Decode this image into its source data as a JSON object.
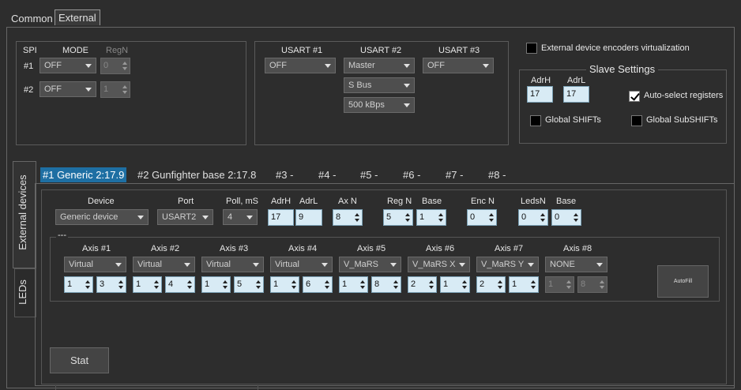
{
  "top_tabs": [
    "Common",
    "External"
  ],
  "spi": {
    "title": "SPI",
    "mode_header": "MODE",
    "regn_header": "RegN",
    "rows": [
      {
        "label": "#1",
        "mode": "OFF",
        "regn": "0"
      },
      {
        "label": "#2",
        "mode": "OFF",
        "regn": "1"
      }
    ]
  },
  "usart": {
    "headers": [
      "USART #1",
      "USART #2",
      "USART #3"
    ],
    "u1": "OFF",
    "u2": [
      "Master",
      "S Bus",
      "500 kBps"
    ],
    "u3": "OFF"
  },
  "ext_enc_label": "External device encoders virtualization",
  "slave": {
    "title": "Slave Settings",
    "adrh_label": "AdrH",
    "adrl_label": "AdrL",
    "adrh": "17",
    "adrl": "17",
    "auto_select_label": "Auto-select registers",
    "global_shifts_label": "Global SHIFTs",
    "global_subshifts_label": "Global SubSHIFTs",
    "auto_select_checked": true
  },
  "side_tabs": [
    "External devices",
    "LEDs"
  ],
  "device_tabs": [
    "#1 Generic 2:17.9",
    "#2 Gunfighter base 2:17.8",
    "#3 -",
    "#4 -",
    "#5 -",
    "#6 -",
    "#7 -",
    "#8 -"
  ],
  "device": {
    "headers": {
      "device": "Device",
      "port": "Port",
      "poll": "Poll, mS",
      "adrh": "AdrH",
      "adrl": "AdrL",
      "axn": "Ax N",
      "regn": "Reg N",
      "base": "Base",
      "encn": "Enc N",
      "ledsn": "LedsN",
      "base2": "Base"
    },
    "device": "Generic device",
    "port": "USART2",
    "poll": "4",
    "adrh": "17",
    "adrl": "9",
    "axn": "8",
    "regn": "5",
    "base": "1",
    "encn": "0",
    "ledsn": "0",
    "base2": "0"
  },
  "group_label": "---",
  "axes": [
    {
      "label": "Axis #1",
      "type": "Virtual",
      "a": "1",
      "b": "3"
    },
    {
      "label": "Axis #2",
      "type": "Virtual",
      "a": "1",
      "b": "4"
    },
    {
      "label": "Axis #3",
      "type": "Virtual",
      "a": "1",
      "b": "5"
    },
    {
      "label": "Axis #4",
      "type": "Virtual",
      "a": "1",
      "b": "6"
    },
    {
      "label": "Axis #5",
      "type": "V_MaRS",
      "a": "1",
      "b": "8"
    },
    {
      "label": "Axis #6",
      "type": "V_MaRS X",
      "a": "2",
      "b": "1"
    },
    {
      "label": "Axis #7",
      "type": "V_MaRS Y",
      "a": "2",
      "b": "1"
    },
    {
      "label": "Axis #8",
      "type": "NONE",
      "a": "1",
      "b": "8"
    }
  ],
  "autofill_label": "AutoFill",
  "stat_label": "Stat"
}
